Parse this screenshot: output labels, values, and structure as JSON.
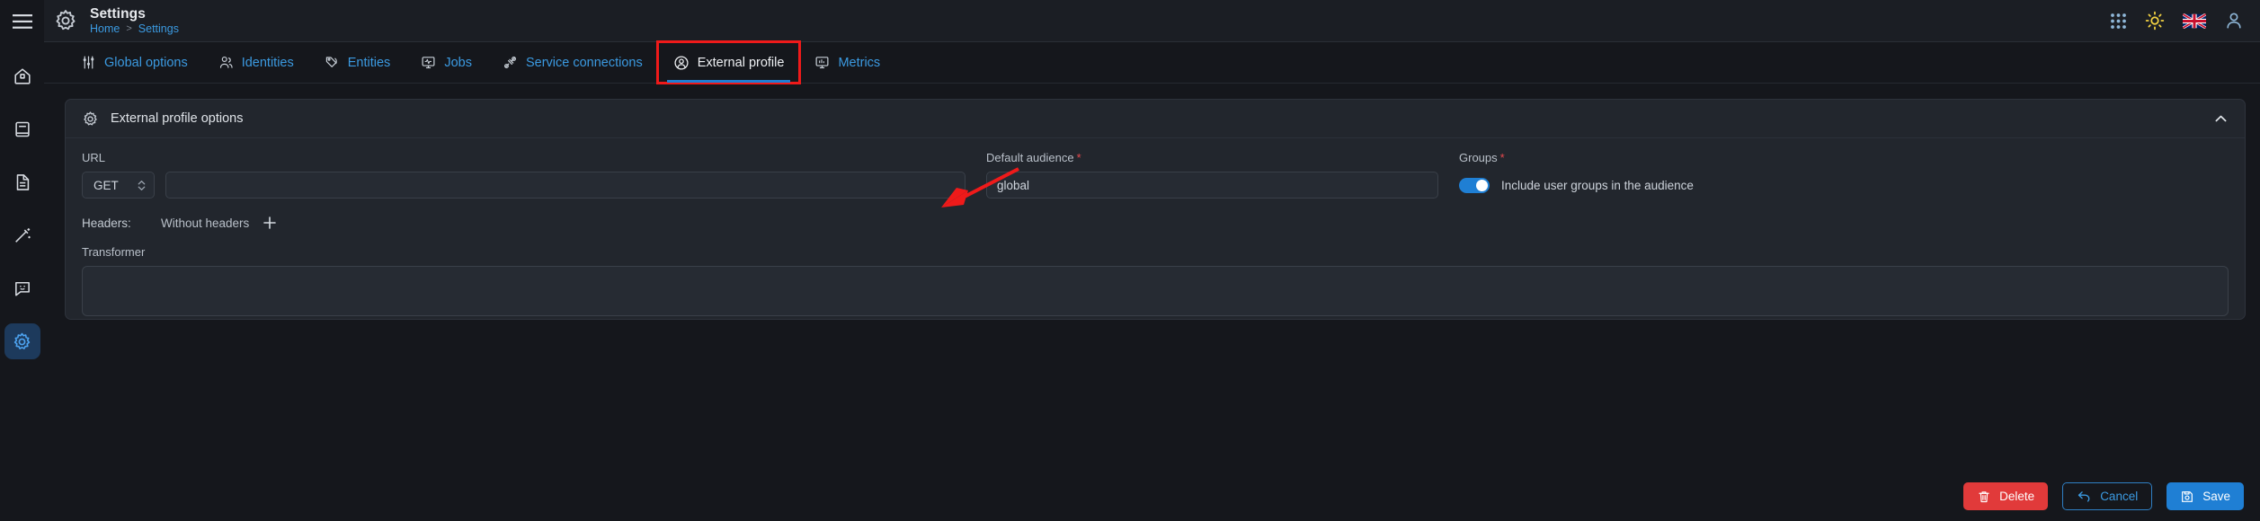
{
  "app": {
    "title": "Settings",
    "breadcrumb": {
      "home": "Home",
      "separator": ">",
      "current": "Settings"
    }
  },
  "rail": {
    "menu_icon": "hamburger-menu-icon",
    "items": [
      {
        "name": "home",
        "icon": "home-icon",
        "active": false
      },
      {
        "name": "library",
        "icon": "book-icon",
        "active": false
      },
      {
        "name": "documents",
        "icon": "document-icon",
        "active": false
      },
      {
        "name": "automation",
        "icon": "magic-wand-icon",
        "active": false
      },
      {
        "name": "feedback",
        "icon": "chat-smiley-icon",
        "active": false
      },
      {
        "name": "settings",
        "icon": "gear-icon",
        "active": true
      }
    ]
  },
  "topbar_right": {
    "apps_icon": "grid-apps-icon",
    "theme_icon": "sun-icon",
    "language_flag": "uk-flag-icon",
    "account_icon": "user-avatar-icon"
  },
  "tabs": [
    {
      "label": "Global options",
      "icon": "sliders-icon",
      "active": false,
      "highlighted": false
    },
    {
      "label": "Identities",
      "icon": "users-icon",
      "active": false,
      "highlighted": false
    },
    {
      "label": "Entities",
      "icon": "tag-icon",
      "active": false,
      "highlighted": false
    },
    {
      "label": "Jobs",
      "icon": "monitor-pulse-icon",
      "active": false,
      "highlighted": false
    },
    {
      "label": "Service connections",
      "icon": "connector-icon",
      "active": false,
      "highlighted": false
    },
    {
      "label": "External profile",
      "icon": "user-circle-icon",
      "active": true,
      "highlighted": true
    },
    {
      "label": "Metrics",
      "icon": "monitor-chart-icon",
      "active": false,
      "highlighted": false
    }
  ],
  "panel": {
    "icon": "gear-icon",
    "title": "External profile options",
    "collapse_icon": "chevron-up-icon",
    "url": {
      "label": "URL",
      "method_value": "GET",
      "method_icon": "chevron-updown-icon",
      "input_value": "",
      "input_placeholder": ""
    },
    "default_audience": {
      "label": "Default audience",
      "required_marker": "*",
      "value": "global",
      "placeholder": ""
    },
    "groups": {
      "label": "Groups",
      "required_marker": "*",
      "toggle_on": true,
      "toggle_text": "Include user groups in the audience"
    },
    "headers": {
      "label": "Headers:",
      "value": "Without headers",
      "add_icon": "plus-icon",
      "add_label": "+"
    },
    "transformer": {
      "label": "Transformer",
      "value": "",
      "placeholder": ""
    }
  },
  "actions": {
    "delete": {
      "label": "Delete",
      "icon": "trash-icon"
    },
    "cancel": {
      "label": "Cancel",
      "icon": "undo-arrow-icon"
    },
    "save": {
      "label": "Save",
      "icon": "floppy-disk-icon"
    }
  },
  "annotations": {
    "highlight_box_color": "#ef1a1a",
    "arrow_color": "#ef1a1a",
    "arrow_target": "Default audience required marker"
  },
  "colors": {
    "accent": "#1f7fd4",
    "link": "#3b9ae1",
    "danger": "#e13a3a",
    "required": "#e5484d",
    "page_bg": "#15171c",
    "panel_bg": "#22262d",
    "field_bg": "#262b33"
  }
}
